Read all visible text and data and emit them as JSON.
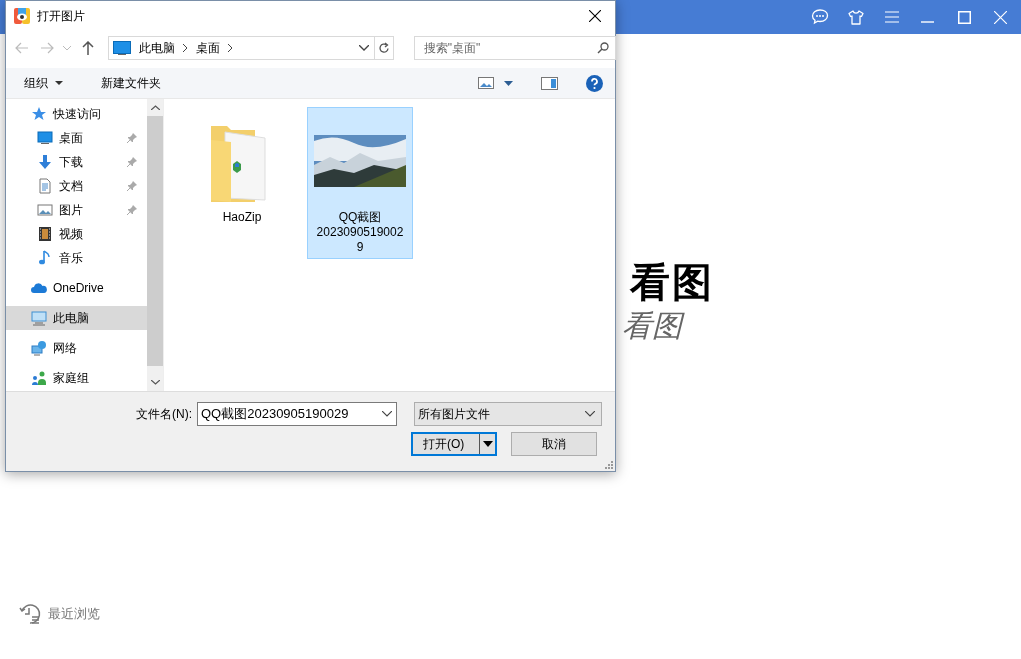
{
  "app": {
    "logo_text": "看图",
    "logo_script": "看图",
    "recent_label": "最近浏览"
  },
  "dialog": {
    "title": "打开图片",
    "breadcrumb": [
      "此电脑",
      "桌面"
    ],
    "search": {
      "placeholder": "搜索\"桌面\""
    },
    "toolbar": {
      "organize": "组织",
      "new_folder": "新建文件夹"
    },
    "nav": [
      {
        "label": "快速访问",
        "kind": "star",
        "selected": false,
        "children": [
          {
            "label": "桌面",
            "kind": "desktop",
            "selected": false,
            "pinned": true
          },
          {
            "label": "下载",
            "kind": "download",
            "selected": false,
            "pinned": true
          },
          {
            "label": "文档",
            "kind": "document",
            "selected": false,
            "pinned": true
          },
          {
            "label": "图片",
            "kind": "picture",
            "selected": false,
            "pinned": true
          },
          {
            "label": "视频",
            "kind": "video",
            "selected": false,
            "pinned": false
          },
          {
            "label": "音乐",
            "kind": "music",
            "selected": false,
            "pinned": false
          }
        ]
      },
      {
        "label": "OneDrive",
        "kind": "cloud",
        "selected": false
      },
      {
        "label": "此电脑",
        "kind": "computer",
        "selected": true
      },
      {
        "label": "网络",
        "kind": "network",
        "selected": false
      },
      {
        "label": "家庭组",
        "kind": "homegroup",
        "selected": false
      }
    ],
    "files": [
      {
        "name": "HaoZip",
        "kind": "folder",
        "selected": false
      },
      {
        "name": "QQ截图20230905190029",
        "kind": "image",
        "selected": true
      }
    ],
    "filename_label": "文件名(N):",
    "filename": "QQ截图20230905190029",
    "filetype": "所有图片文件",
    "open_button": "打开(O)",
    "cancel_button": "取消"
  }
}
